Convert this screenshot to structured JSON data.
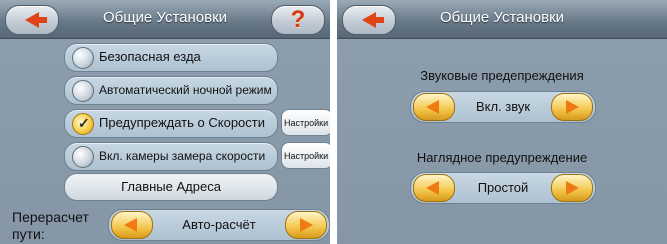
{
  "left": {
    "title": "Общие Установки",
    "options": [
      {
        "label": "Безопасная езда",
        "checked": false
      },
      {
        "label": "Автоматический ночной режим",
        "checked": false
      },
      {
        "label": "Предупреждать о Скорости",
        "checked": true
      },
      {
        "label": "Вкл. камеры замера скорости",
        "checked": false
      }
    ],
    "settings_button_1": "Настройки",
    "settings_button_2": "Настройки",
    "main_addresses_button": "Главные Адреса",
    "recalc_label": "Перерасчет пути:",
    "recalc_value": "Авто-расчёт"
  },
  "right": {
    "title": "Общие Установки",
    "sound_label": "Звуковые предепреждения",
    "sound_value": "Вкл. звук",
    "visual_label": "Наглядное предупреждение",
    "visual_value": "Простой"
  },
  "icons": {
    "back": "back-arrow-icon",
    "help": "question-mark-icon",
    "prev": "left-arrow-icon",
    "next": "right-arrow-icon",
    "radio": "radio-icon",
    "check": "checkmark-icon"
  },
  "colors": {
    "panel_bg": "#8d9fae",
    "titlebar": "#667785",
    "accent_arrow": "#e04316",
    "selector_arrow": "#f3c64c"
  }
}
